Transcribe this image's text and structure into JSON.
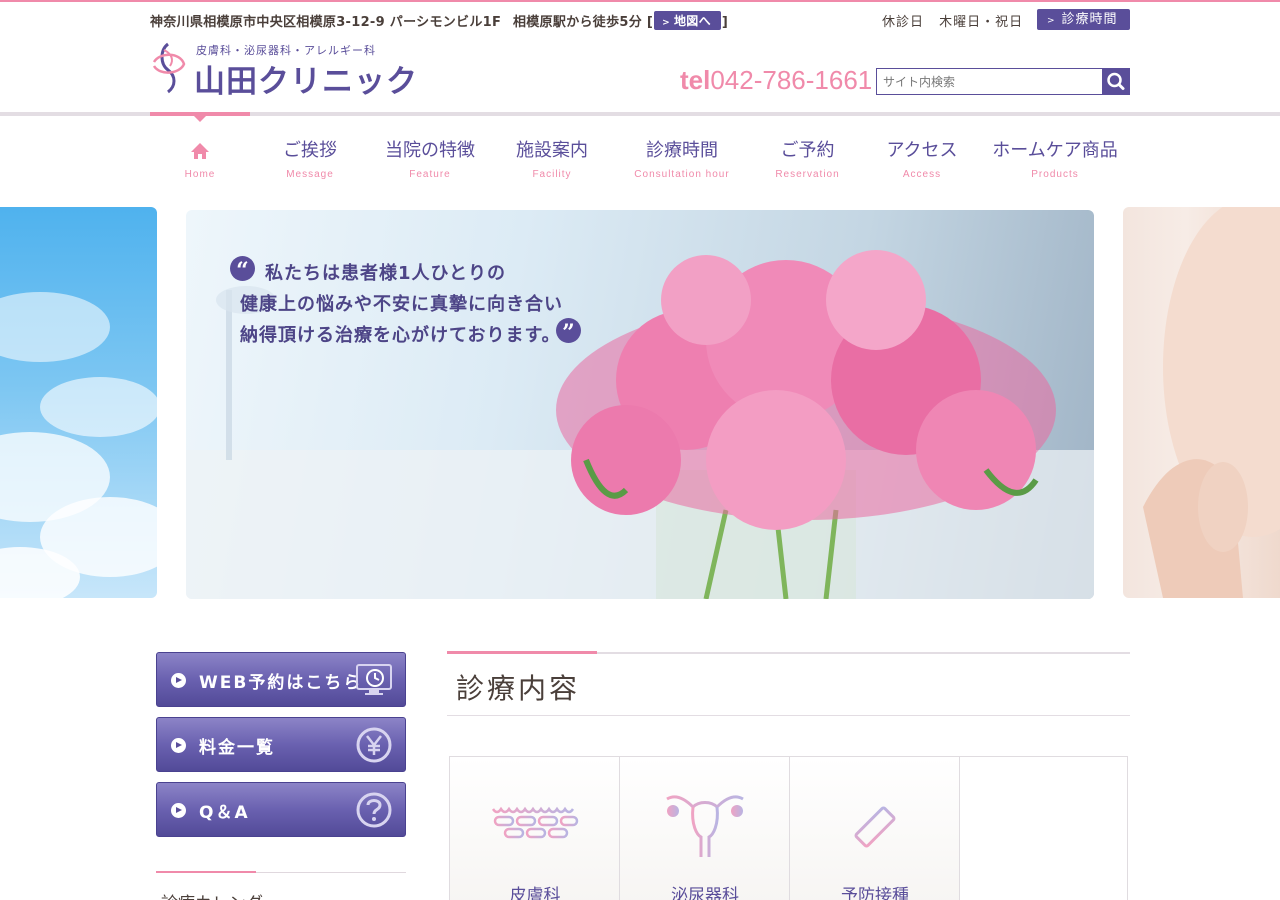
{
  "header": {
    "address": "神奈川県相模原市中央区相模原3-12-9 パーシモンビル1F",
    "access": "相模原駅から徒歩5分",
    "bracket_open": "[",
    "bracket_close": "]",
    "map_button": "地図へ",
    "closed_label": "休診日",
    "closed_days": "木曜日・祝日",
    "hours_button": "診療時間",
    "arrow": ">",
    "logo_sub": "皮膚科・泌尿器科・アレルギー科",
    "logo_main": "山田クリニック",
    "tel_prefix": "tel",
    "tel_number": "042-786-1661",
    "search_placeholder": "サイト内検索"
  },
  "nav": [
    {
      "jp": "",
      "en": "Home",
      "icon": "home-icon"
    },
    {
      "jp": "ご挨拶",
      "en": "Message"
    },
    {
      "jp": "当院の特徴",
      "en": "Feature"
    },
    {
      "jp": "施設案内",
      "en": "Facility"
    },
    {
      "jp": "診療時間",
      "en": "Consultation hour"
    },
    {
      "jp": "ご予約",
      "en": "Reservation"
    },
    {
      "jp": "アクセス",
      "en": "Access"
    },
    {
      "jp": "ホームケア商品",
      "en": "Products"
    }
  ],
  "hero": {
    "line1": "私たちは患者様1人ひとりの",
    "line2": "健康上の悩みや不安に真摯に向き合い",
    "line3": "納得頂ける治療を心がけております。",
    "open_quote": "“",
    "close_quote": "”"
  },
  "sidebar": {
    "buttons": [
      {
        "label": "WEB予約はこちら",
        "icon": "monitor-clock-icon"
      },
      {
        "label": "料金一覧",
        "icon": "yen-icon"
      },
      {
        "label": "Q＆A",
        "icon": "question-icon"
      }
    ],
    "calendar_title": "診療カレンダー"
  },
  "main": {
    "section_title": "診療内容",
    "departments": [
      {
        "name": "皮膚科",
        "icon": "skin-cells-icon"
      },
      {
        "name": "泌尿器科",
        "icon": "uterus-icon"
      },
      {
        "name": "予防接種",
        "icon": "syringe-icon"
      }
    ]
  },
  "colors": {
    "accent_pink": "#f08aaa",
    "brand_purple": "#5a4e9a",
    "text_brown": "#4a3f3a"
  }
}
